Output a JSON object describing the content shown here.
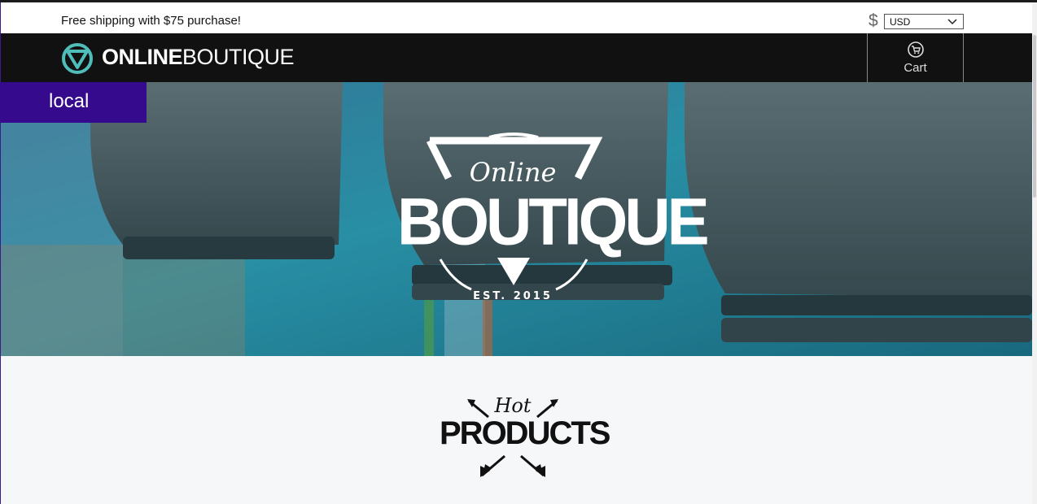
{
  "topbar": {
    "shipping_message": "Free shipping with $75 purchase!",
    "currency_symbol": "$",
    "currency_selected": "USD"
  },
  "header": {
    "logo_bold": "ONLINE",
    "logo_light": "BOUTIQUE",
    "cart_label": "Cart"
  },
  "environment_badge": "local",
  "hero": {
    "script_text": "Online",
    "main_text": "BOUTIQUE",
    "est_text": "EST. 2015"
  },
  "section": {
    "script_text": "Hot",
    "main_text": "PRODUCTS"
  },
  "colors": {
    "header_bg": "#111111",
    "badge_bg": "#350a8c",
    "logo_teal": "#4fbdba",
    "page_bg": "#f6f7f9"
  }
}
